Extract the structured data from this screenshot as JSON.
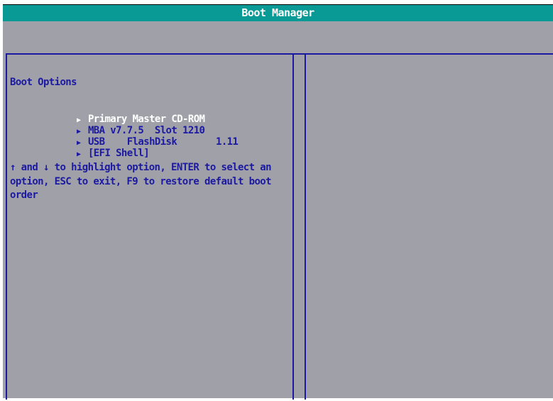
{
  "window": {
    "title": "Boot Manager"
  },
  "left_pane": {
    "heading": "Boot Options",
    "options": [
      {
        "label": "Primary Master CD-ROM",
        "selected": true
      },
      {
        "label": "MBA v7.7.5  Slot 1210",
        "selected": false
      },
      {
        "label": "USB    FlashDisk       1.11",
        "selected": false
      },
      {
        "label": "[EFI Shell]",
        "selected": false
      }
    ],
    "help_lines": [
      "↑ and ↓ to highlight option, ENTER to select an",
      "option, ESC to exit, F9 to restore default boot",
      "order"
    ]
  },
  "icons": {
    "option_marker": "right-triangle-icon",
    "marker_glyph": "▶"
  },
  "colors": {
    "title_bar": "#0a9a96",
    "background": "#a0a0a8",
    "frame_blue": "#1c1aa0",
    "text_blue": "#1c1aa0",
    "selected_text": "#ffffff"
  }
}
